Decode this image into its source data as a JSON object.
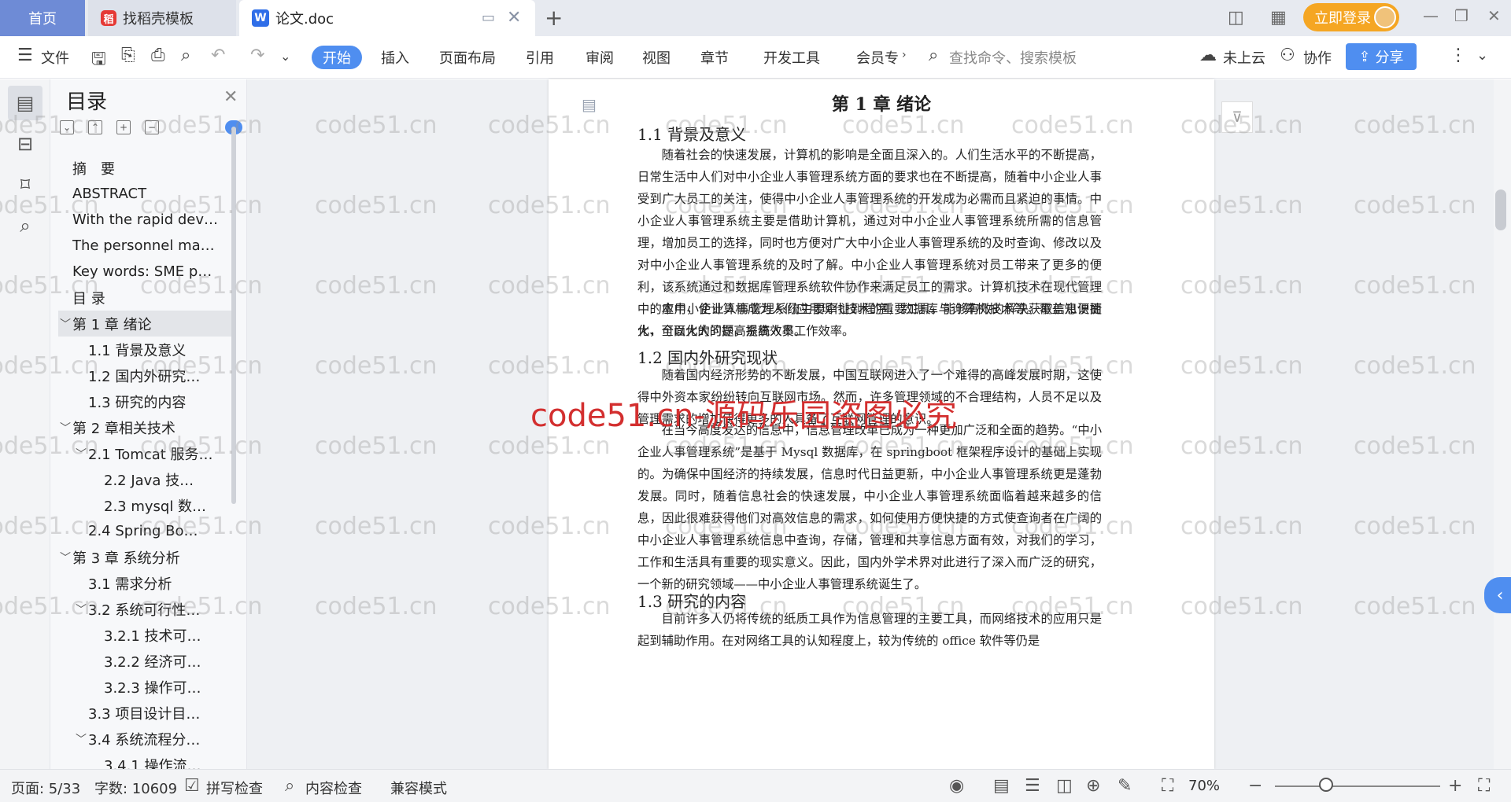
{
  "tabs": {
    "home": "首页",
    "template": "找稻壳模板",
    "doc": "论文.doc"
  },
  "titlebar": {
    "login": "立即登录"
  },
  "ribbon": {
    "file": "文件",
    "tabs": [
      "开始",
      "插入",
      "页面布局",
      "引用",
      "审阅",
      "视图",
      "章节",
      "开发工具",
      "会员专"
    ],
    "search": "查找命令、搜索模板",
    "cloud": "未上云",
    "collab": "协作",
    "share": "分享"
  },
  "nav": {
    "title": "目录",
    "items": [
      {
        "text": "摘　要",
        "level": 1,
        "caret": ""
      },
      {
        "text": "ABSTRACT",
        "level": 1,
        "caret": ""
      },
      {
        "text": "With the rapid dev…",
        "level": 1,
        "caret": ""
      },
      {
        "text": "The personnel ma…",
        "level": 1,
        "caret": ""
      },
      {
        "text": "Key words: SME p…",
        "level": 1,
        "caret": ""
      },
      {
        "text": "目  录",
        "level": 1,
        "caret": ""
      },
      {
        "text": "第 1 章  绪论",
        "level": 1,
        "caret": "﹀"
      },
      {
        "text": "1.1 背景及意义",
        "level": 2,
        "caret": ""
      },
      {
        "text": "1.2  国内外研究…",
        "level": 2,
        "caret": ""
      },
      {
        "text": "1.3  研究的内容",
        "level": 2,
        "caret": ""
      },
      {
        "text": "第 2 章相关技术",
        "level": 1,
        "caret": "﹀"
      },
      {
        "text": "2.1 Tomcat 服务…",
        "level": 2,
        "caret": "﹀"
      },
      {
        "text": "2.2    Java 技…",
        "level": 3,
        "caret": ""
      },
      {
        "text": "2.3 mysql 数…",
        "level": 3,
        "caret": ""
      },
      {
        "text": "2.4 Spring    Bo…",
        "level": 2,
        "caret": ""
      },
      {
        "text": "第 3 章  系统分析",
        "level": 1,
        "caret": "﹀"
      },
      {
        "text": "3.1  需求分析",
        "level": 2,
        "caret": ""
      },
      {
        "text": "3.2  系统可行性…",
        "level": 2,
        "caret": "﹀"
      },
      {
        "text": "3.2.1 技术可…",
        "level": 3,
        "caret": ""
      },
      {
        "text": "3.2.2 经济可…",
        "level": 3,
        "caret": ""
      },
      {
        "text": "3.2.3 操作可…",
        "level": 3,
        "caret": ""
      },
      {
        "text": "3.3  项目设计目…",
        "level": 2,
        "caret": ""
      },
      {
        "text": "3.4 系统流程分…",
        "level": 2,
        "caret": "﹀"
      },
      {
        "text": "3.4.1 操作流…",
        "level": 3,
        "caret": ""
      }
    ]
  },
  "document": {
    "h1": "第 1 章  绪论",
    "s11": "1.1 背景及意义",
    "p1": "随着社会的快速发展，计算机的影响是全面且深入的。人们生活水平的不断提高，日常生活中人们对中小企业人事管理系统方面的要求也在不断提高，随着中小企业人事受到广大员工的关注，使得中小企业人事管理系统的开发成为必需而且紧迫的事情。中小企业人事管理系统主要是借助计算机，通过对中小企业人事管理系统所需的信息管理，增加员工的选择，同时也方便对广大中小企业人事管理系统的及时查询、修改以及对中小企业人事管理系统的及时了解。中小企业人事管理系统对员工带来了更多的便利，该系统通过和数据库管理系统软件协作来满足员工的需求。计算机技术在现代管理中的应用，使计算机成为人们应用现代技术的重要工具。能够有效的解决获取信息便捷化、全面化的问题，提高效率。",
    "p2": "本中小企业人事管理系统主要牵扯到程序，数据库与计算机技术等。覆盖知识面大，可以大大的提高系统人员工作效率。",
    "s12": "1.2  国内外研究现状",
    "p3": "随着国内经济形势的不断发展，中国互联网进入了一个难得的高峰发展时期，这使得中外资本家纷纷转向互联网市场。然而，许多管理领域的不合理结构，人员不足以及管理需求的增加使得更多的人具备了互联网管理的意识。",
    "p4": "在当今高度发达的信息中，信息管理改革已成为一种更加广泛和全面的趋势。“中小企业人事管理系统”是基于 Mysql 数据库，在 springboot 框架程序设计的基础上实现的。为确保中国经济的持续发展，信息时代日益更新，中小企业人事管理系统更是蓬勃发展。同时，随着信息社会的快速发展，中小企业人事管理系统面临着越来越多的信息，因此很难获得他们对高效信息的需求，如何使用方便快捷的方式使查询者在广阔的中小企业人事管理系统信息中查询，存储，管理和共享信息方面有效，对我们的学习，工作和生活具有重要的现实意义。因此，国内外学术界对此进行了深入而广泛的研究，一个新的研究领域——中小企业人事管理系统诞生了。",
    "s13": "1.3  研究的内容",
    "p5": "目前许多人仍将传统的纸质工具作为信息管理的主要工具，而网络技术的应用只是起到辅助作用。在对网络工具的认知程度上，较为传统的 office 软件等仍是"
  },
  "watermark": {
    "small": "code51.cn",
    "big": "code51.cn-源码乐园盗图必究"
  },
  "status": {
    "page": "页面: 5/33",
    "words": "字数: 10609",
    "spell": "拼写检查",
    "content": "内容检查",
    "compat": "兼容模式",
    "zoom": "70%"
  },
  "colors": {
    "accent": "#4f8ef0",
    "login": "#f5a623",
    "watermark_big": "#d32f2f"
  }
}
